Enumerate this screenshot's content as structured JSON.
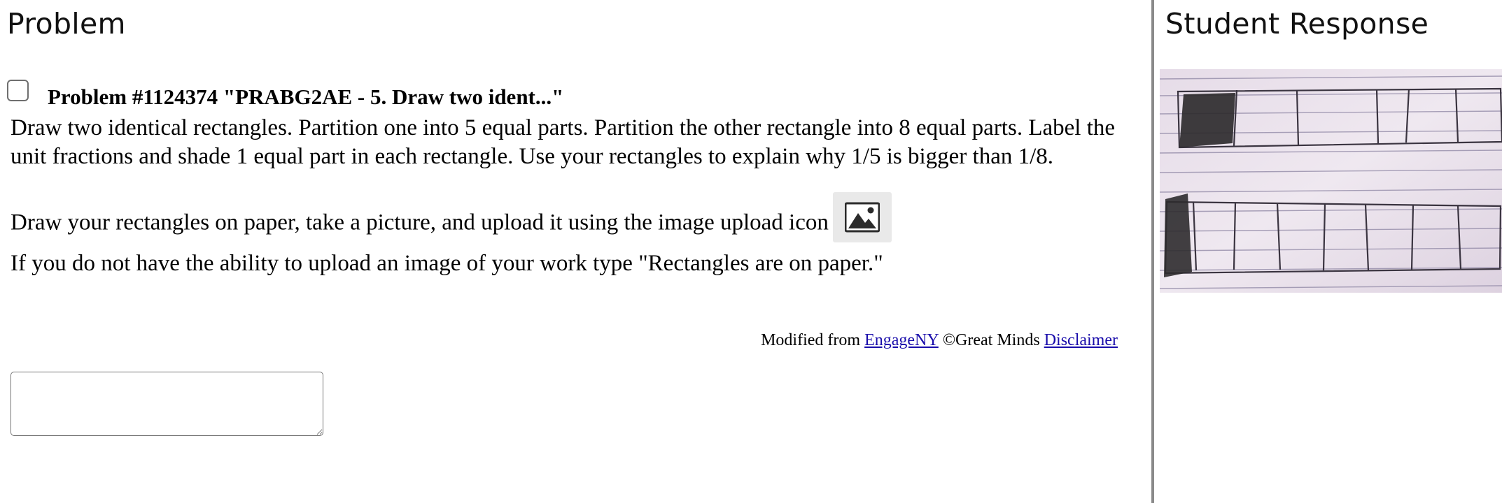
{
  "left_panel": {
    "title": "Problem",
    "problem": {
      "header": "Problem #1124374 \"PRABG2AE - 5. Draw two ident...\"",
      "para1": "Draw two identical rectangles. Partition one into 5 equal parts. Partition the other rectangle into 8 equal parts. Label the unit fractions and shade 1 equal part in each rectangle. Use your rectangles to explain why 1/5 is bigger than 1/8.",
      "para2": "Draw your rectangles on paper, take a picture, and upload it using the image upload icon",
      "para3": "If you do not have the ability to upload an image of your work type \"Rectangles are on paper.\""
    },
    "attribution": {
      "prefix": "Modified from",
      "engage_link": "EngageNY",
      "middle": "©Great Minds",
      "disclaimer_link": "Disclaimer"
    },
    "answer_box": {
      "value": ""
    }
  },
  "right_panel": {
    "title": "Student Response"
  },
  "colors": {
    "divider": "#8a8a8a",
    "link": "#1a0dab",
    "upload_icon_bg": "#e9e9e9"
  },
  "icons": {
    "upload": "image-icon",
    "checkbox": "checkbox-unchecked"
  }
}
